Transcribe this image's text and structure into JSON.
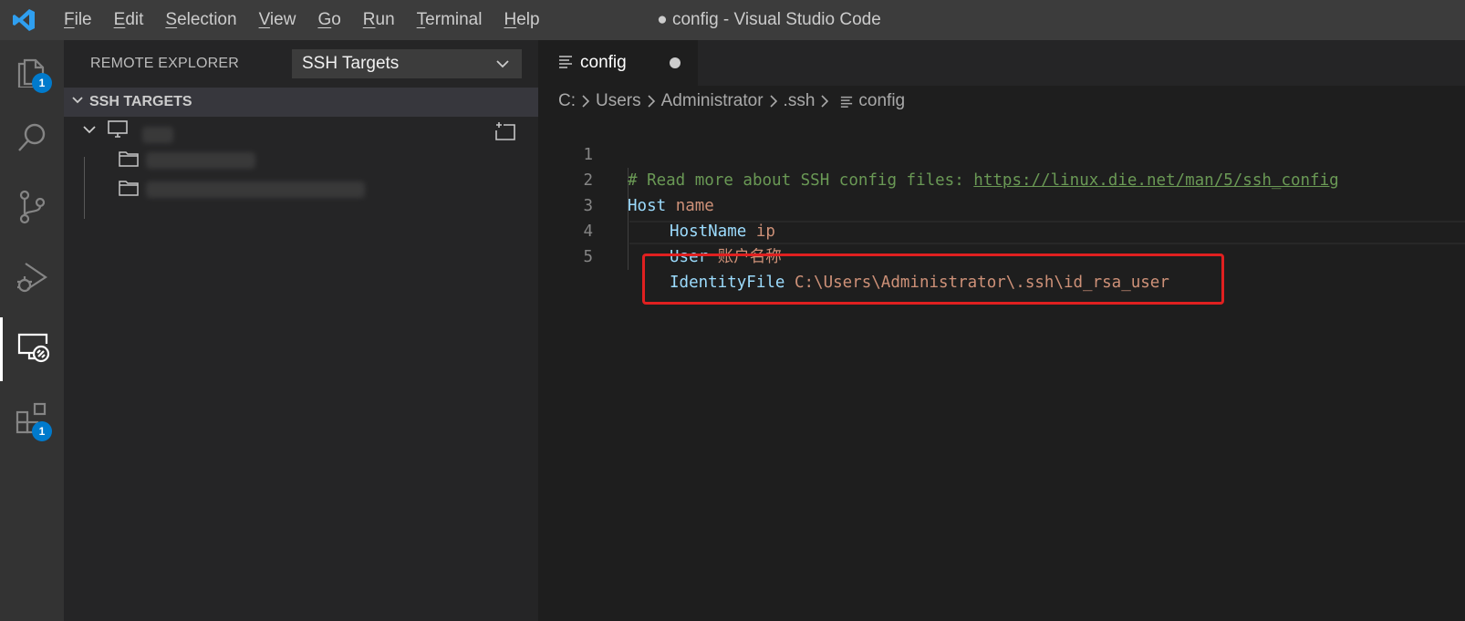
{
  "window": {
    "title": "● config - Visual Studio Code"
  },
  "menu": [
    {
      "mnemonic": "F",
      "rest": "ile"
    },
    {
      "mnemonic": "E",
      "rest": "dit"
    },
    {
      "mnemonic": "S",
      "rest": "election"
    },
    {
      "mnemonic": "V",
      "rest": "iew"
    },
    {
      "mnemonic": "G",
      "rest": "o"
    },
    {
      "mnemonic": "R",
      "rest": "un"
    },
    {
      "mnemonic": "T",
      "rest": "erminal"
    },
    {
      "mnemonic": "H",
      "rest": "elp"
    }
  ],
  "activity": {
    "explorer_badge": "1",
    "extensions_badge": "1"
  },
  "sidebar": {
    "title": "REMOTE EXPLORER",
    "dropdown_value": "SSH Targets",
    "section_title": "SSH TARGETS"
  },
  "editor": {
    "tab_label": "config",
    "breadcrumbs": [
      "C:",
      "Users",
      "Administrator",
      ".ssh",
      "config"
    ],
    "lines": [
      {
        "n": "1",
        "comment": "# Read more about SSH config files: ",
        "link": "https://linux.die.net/man/5/ssh_config"
      },
      {
        "n": "2",
        "key": "Host",
        "value": "name"
      },
      {
        "n": "3",
        "key": "HostName",
        "value": "ip"
      },
      {
        "n": "4",
        "key": "User",
        "value": "账户名称"
      },
      {
        "n": "5",
        "key": "IdentityFile",
        "value": "C:\\Users\\Administrator\\.ssh\\id_rsa_user"
      }
    ]
  },
  "colors": {
    "highlight_box": "#e02020",
    "accent": "#007acc"
  }
}
